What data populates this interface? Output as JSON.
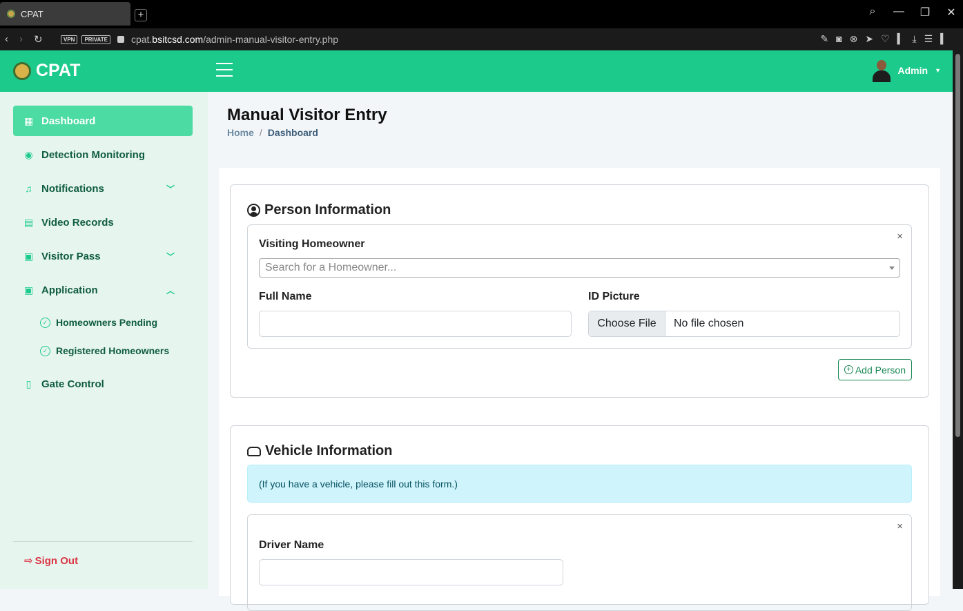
{
  "browser": {
    "tab_title": "CPAT",
    "new_tab": "+",
    "url_prefix": "cpat.",
    "url_domain": "bsitcsd.com",
    "url_path": "/admin-manual-visitor-entry.php",
    "badges": [
      "VPN",
      "PRIVATE"
    ]
  },
  "header": {
    "brand": "CPAT",
    "user": "Admin",
    "accent_color": "#1ccb8b"
  },
  "sidebar": {
    "items": [
      {
        "label": "Dashboard",
        "icon": "grid-icon"
      },
      {
        "label": "Detection Monitoring",
        "icon": "eye-icon"
      },
      {
        "label": "Notifications",
        "icon": "bell-icon"
      },
      {
        "label": "Video Records",
        "icon": "film-icon"
      },
      {
        "label": "Visitor Pass",
        "icon": "pass-icon"
      },
      {
        "label": "Application",
        "icon": "person-badge-icon"
      },
      {
        "label": "Gate Control",
        "icon": "door-icon"
      }
    ],
    "sub_items": [
      {
        "label": "Homeowners Pending"
      },
      {
        "label": "Registered Homeowners"
      }
    ],
    "signout": "Sign Out"
  },
  "main": {
    "title": "Manual Visitor Entry",
    "breadcrumb": {
      "home": "Home",
      "sep": "/",
      "current": "Dashboard"
    },
    "person": {
      "title": "Person Information",
      "close": "×",
      "homeowner_label": "Visiting Homeowner",
      "homeowner_placeholder": "Search for a Homeowner...",
      "fullname_label": "Full Name",
      "fullname_value": "",
      "id_label": "ID Picture",
      "choose_file": "Choose File",
      "no_file": "No file chosen",
      "add_person": "Add Person",
      "add_icon": "+"
    },
    "vehicle": {
      "title": "Vehicle Information",
      "notice": "(If you have a vehicle, please fill out this form.)",
      "close": "×",
      "driver_label": "Driver Name",
      "driver_value": ""
    }
  }
}
